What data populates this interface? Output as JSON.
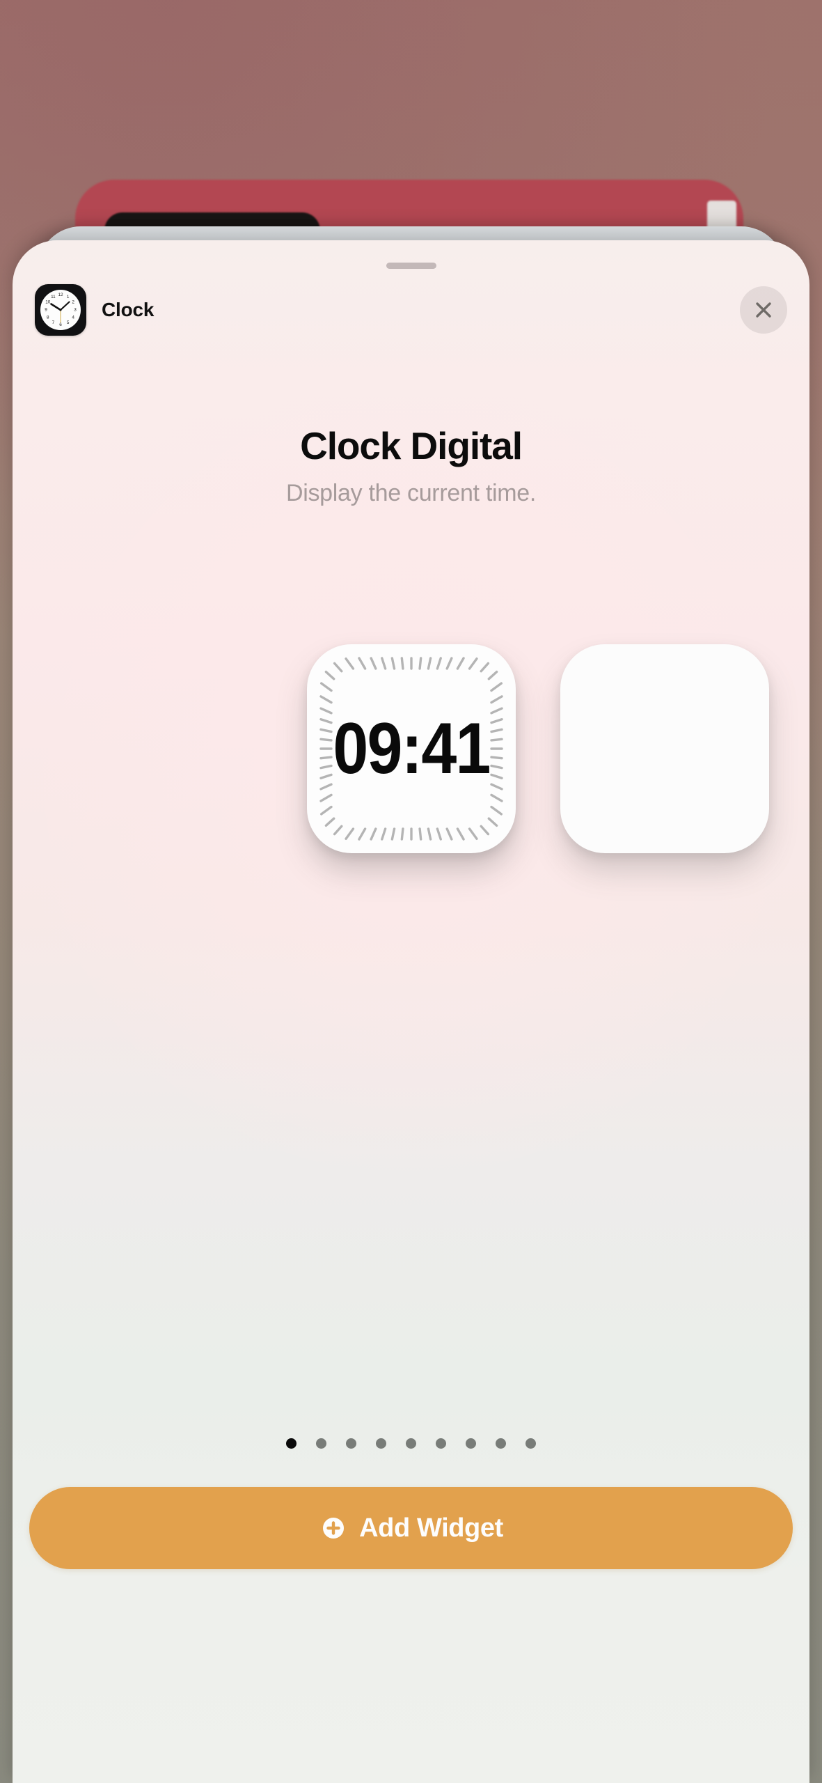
{
  "backdrop": {
    "description": "blurred-home-screen",
    "colors": {
      "top": "#a4716c",
      "bottom": "#8a8b80",
      "card_red": "#bb4350"
    }
  },
  "sheet": {
    "grabber": "drag-handle",
    "colors": {
      "top": "#f7eeec",
      "center_pink": "#fbe9ea",
      "bottom": "#eff1ed"
    }
  },
  "header": {
    "app_name": "Clock",
    "app_icon": "clock-icon",
    "close_icon": "close-icon"
  },
  "details": {
    "title": "Clock Digital",
    "subtitle": "Display the current time."
  },
  "widget_preview": {
    "time": "09:41",
    "style": "digital-with-tick-bezel",
    "background": "#fdfdfd",
    "tick_color": "#b4b4b4",
    "tick_count": 60
  },
  "pager": {
    "total": 9,
    "active_index": 0,
    "dots": [
      {
        "label": "page-1",
        "active": true
      },
      {
        "label": "page-2",
        "active": false
      },
      {
        "label": "page-3",
        "active": false
      },
      {
        "label": "page-4",
        "active": false
      },
      {
        "label": "page-5",
        "active": false
      },
      {
        "label": "page-6",
        "active": false
      },
      {
        "label": "page-7",
        "active": false
      },
      {
        "label": "page-8",
        "active": false
      },
      {
        "label": "page-9",
        "active": false
      }
    ]
  },
  "add_button": {
    "label": "Add Widget",
    "icon": "plus-circle-icon",
    "color": "#e2a14d",
    "text_color": "#fdfdfd"
  }
}
